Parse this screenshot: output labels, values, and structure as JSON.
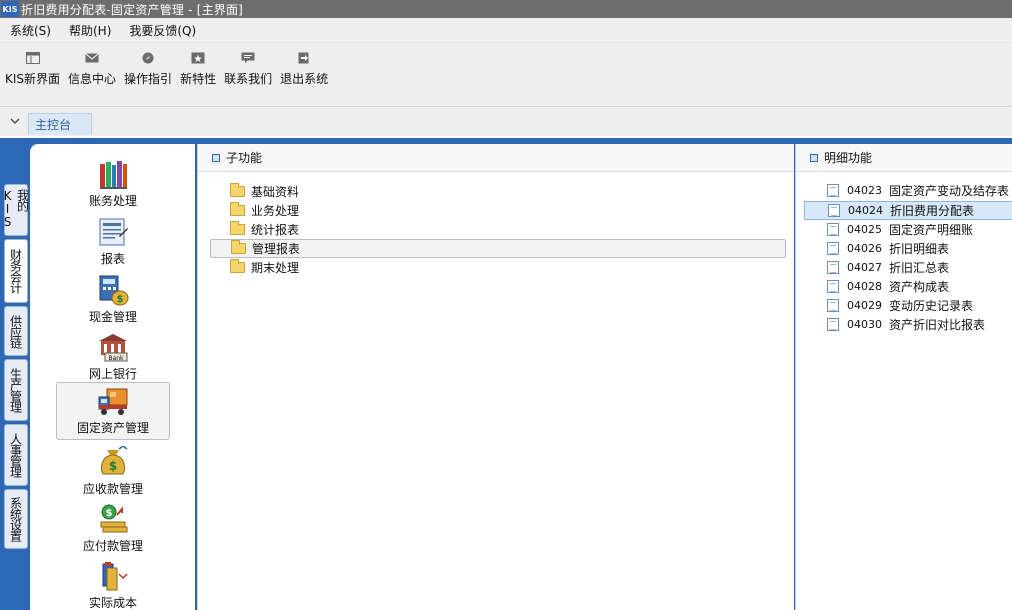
{
  "window": {
    "logo_text": "KIS",
    "title": "折旧费用分配表-固定资产管理 - [主界面]"
  },
  "menu": [
    {
      "label": "系统(S)"
    },
    {
      "label": "帮助(H)"
    },
    {
      "label": "我要反馈(Q)"
    }
  ],
  "toolbar": [
    {
      "label": "KIS新界面",
      "icon": "layout-icon"
    },
    {
      "label": "信息中心",
      "icon": "mail-icon"
    },
    {
      "label": "操作指引",
      "icon": "compass-icon"
    },
    {
      "label": "新特性",
      "icon": "star-icon"
    },
    {
      "label": "联系我们",
      "icon": "chat-icon"
    },
    {
      "label": "退出系统",
      "icon": "exit-icon"
    }
  ],
  "tabs": {
    "active": "主控台"
  },
  "side_tabs": [
    {
      "label": "我的KIS"
    },
    {
      "label": "财务会计"
    },
    {
      "label": "供应链"
    },
    {
      "label": "生产管理"
    },
    {
      "label": "人事管理"
    },
    {
      "label": "系统设置"
    }
  ],
  "nav": [
    {
      "label": "账务处理",
      "icon": "books-icon"
    },
    {
      "label": "报表",
      "icon": "report-icon"
    },
    {
      "label": "现金管理",
      "icon": "calculator-money-icon"
    },
    {
      "label": "网上银行",
      "icon": "bank-icon"
    },
    {
      "label": "固定资产管理",
      "icon": "truck-icon",
      "selected": true
    },
    {
      "label": "应收款管理",
      "icon": "moneybag-icon"
    },
    {
      "label": "应付款管理",
      "icon": "money-out-icon"
    },
    {
      "label": "实际成本",
      "icon": "cost-icon"
    }
  ],
  "sub_panel": {
    "header": "子功能",
    "items": [
      {
        "label": "基础资料"
      },
      {
        "label": "业务处理"
      },
      {
        "label": "统计报表"
      },
      {
        "label": "管理报表",
        "selected": true
      },
      {
        "label": "期末处理"
      }
    ]
  },
  "detail_panel": {
    "header": "明细功能",
    "items": [
      {
        "code": "04023",
        "label": "固定资产变动及结存表"
      },
      {
        "code": "04024",
        "label": "折旧费用分配表",
        "selected": true
      },
      {
        "code": "04025",
        "label": "固定资产明细账"
      },
      {
        "code": "04026",
        "label": "折旧明细表"
      },
      {
        "code": "04027",
        "label": "折旧汇总表"
      },
      {
        "code": "04028",
        "label": "资产构成表"
      },
      {
        "code": "04029",
        "label": "变动历史记录表"
      },
      {
        "code": "04030",
        "label": "资产折旧对比报表"
      }
    ]
  },
  "colors": {
    "frame_blue": "#2d68b6",
    "selection_blue": "#d6e8fa",
    "title_gray": "#6e6e6e"
  }
}
